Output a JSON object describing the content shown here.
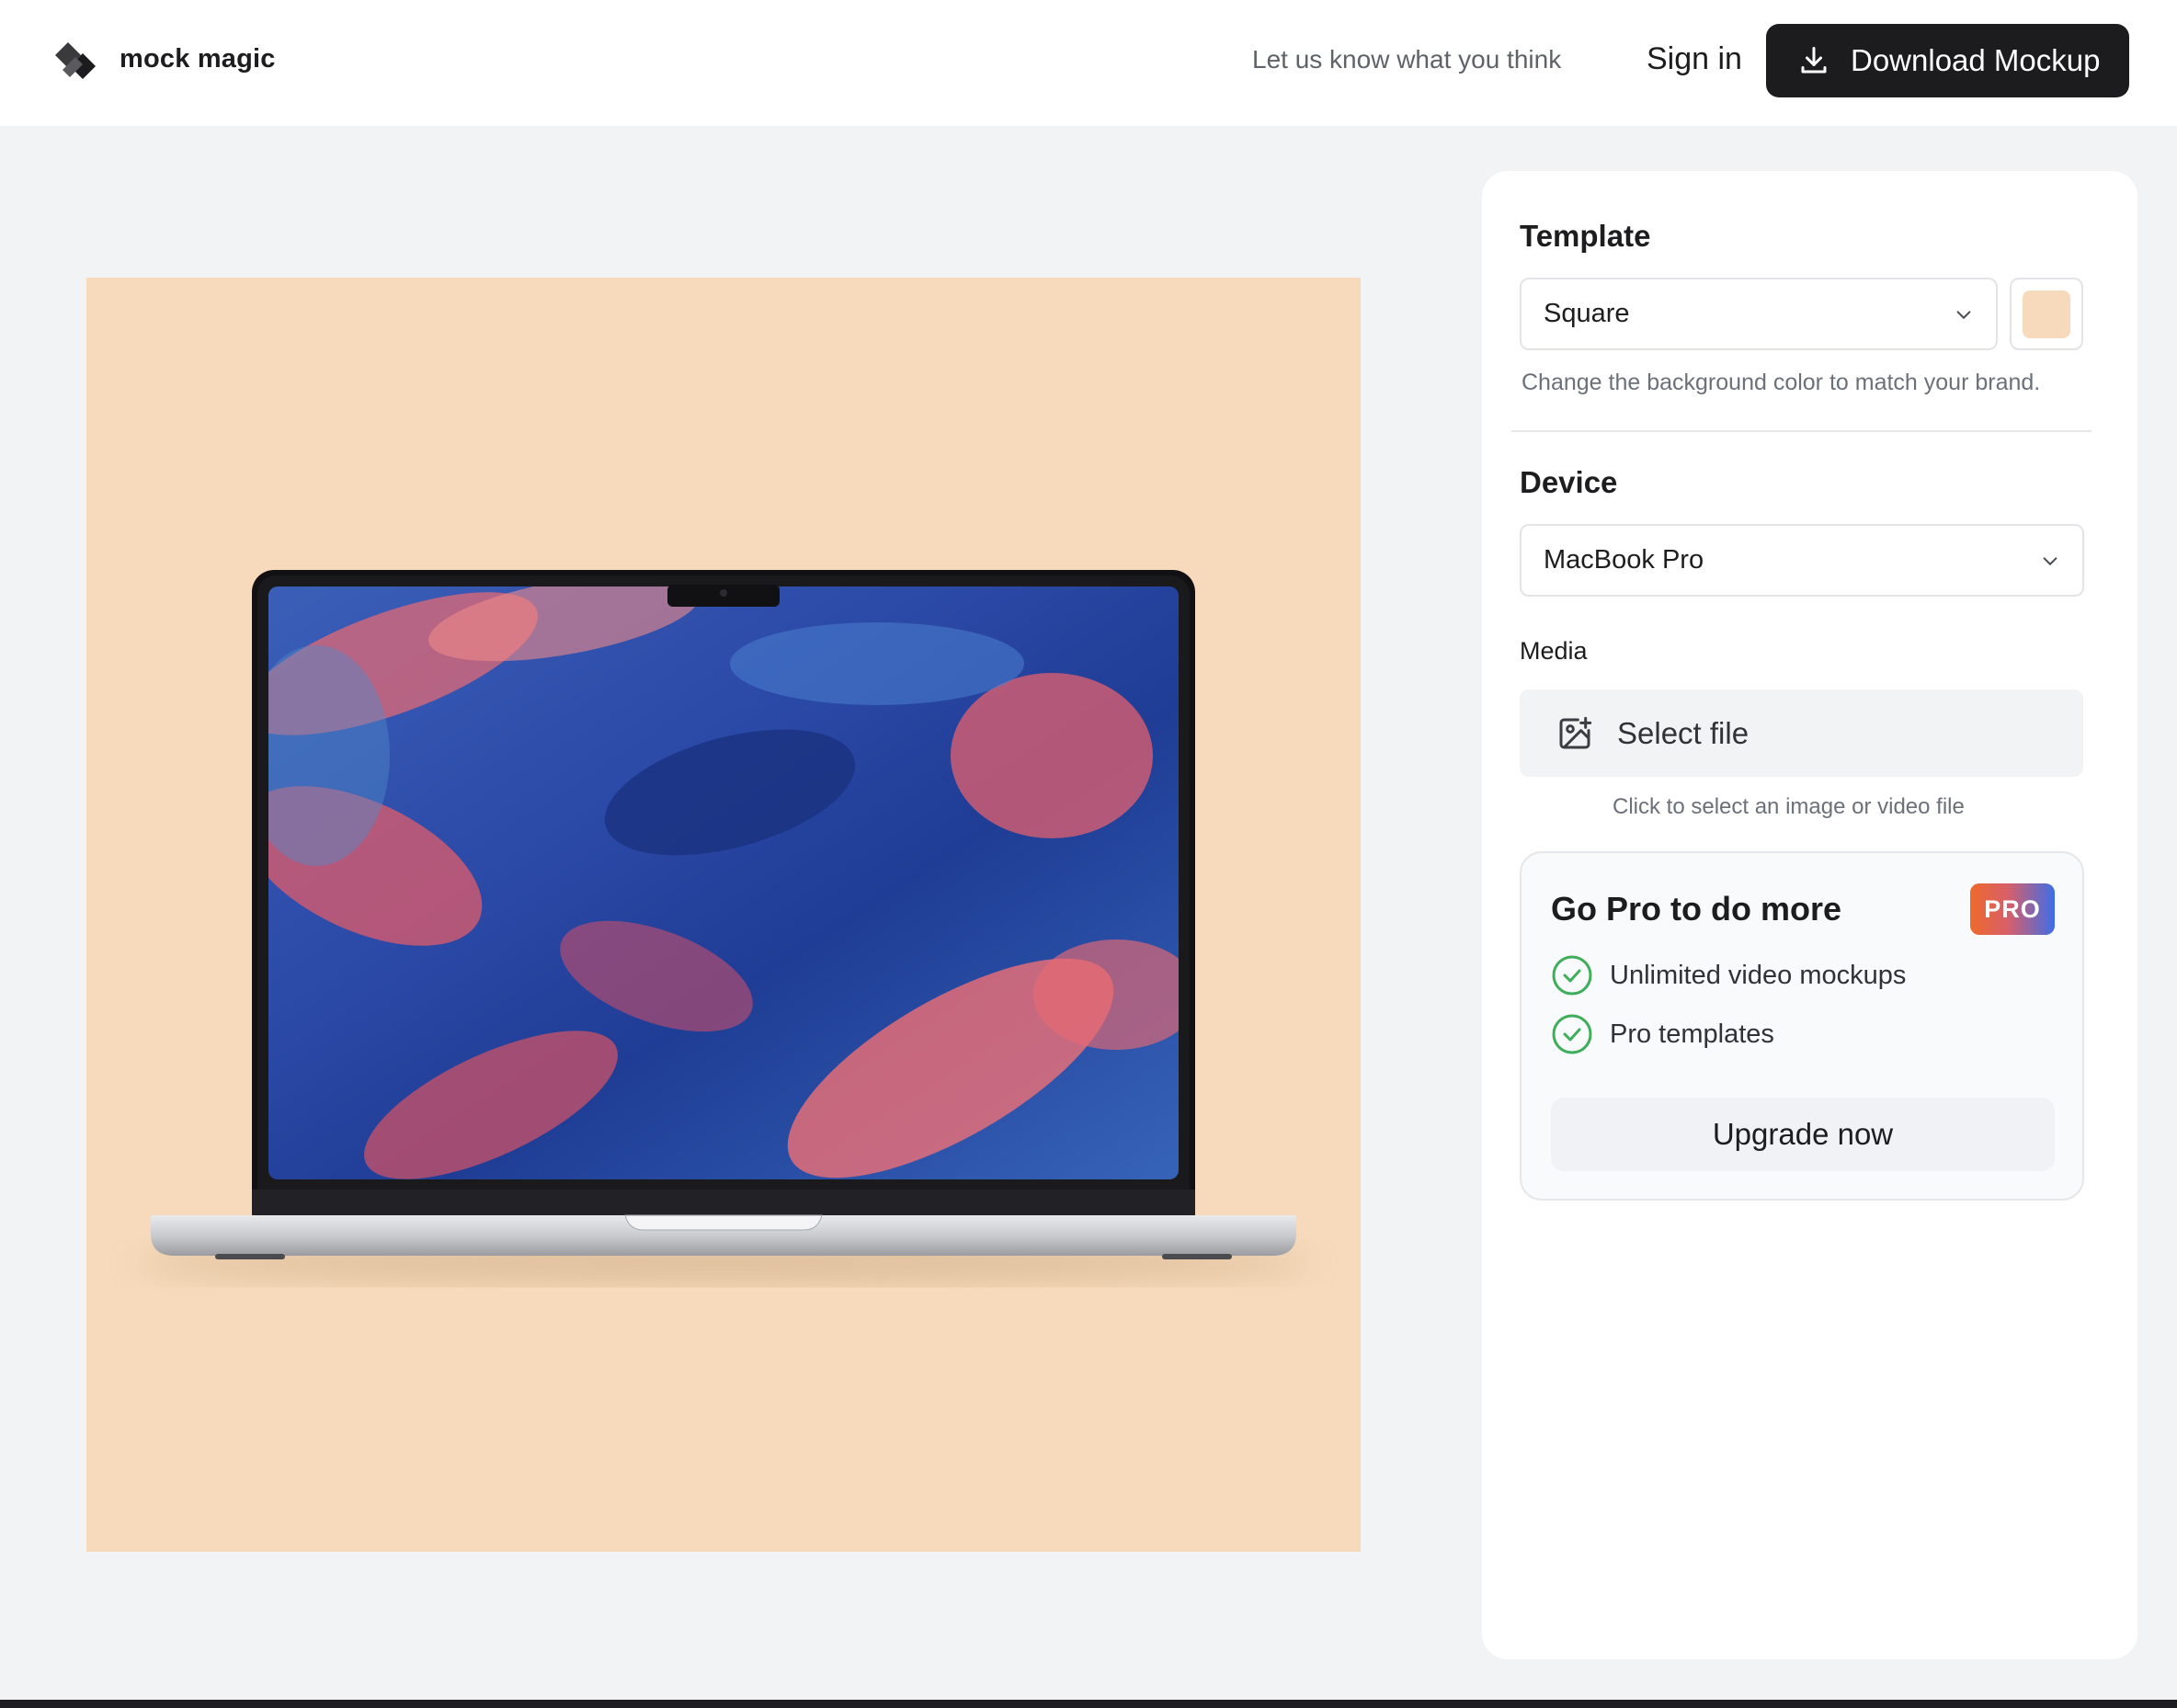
{
  "header": {
    "brand": "mock magic",
    "logo_icon": "stacked-shapes-logo",
    "feedback_link": "Let us know what you think",
    "signin_label": "Sign in",
    "download_label": "Download Mockup",
    "download_icon": "download-icon"
  },
  "canvas": {
    "background_color": "#f6dabb",
    "device_image": "macbook-pro-with-painted-wallpaper"
  },
  "panel": {
    "template": {
      "title": "Template",
      "selected": "Square",
      "swatch_color": "#f6dabb",
      "hint": "Change the background color to match your brand."
    },
    "device": {
      "title": "Device",
      "selected": "MacBook Pro"
    },
    "media": {
      "label": "Media",
      "select_file_label": "Select file",
      "select_file_icon": "image-add-icon",
      "hint": "Click to select an image or video file"
    },
    "pro": {
      "title": "Go Pro to do more",
      "badge": "PRO",
      "features": [
        "Unlimited video mockups",
        "Pro templates"
      ],
      "feature_icon": "check-circle-icon",
      "upgrade_label": "Upgrade now"
    }
  },
  "colors": {
    "accent_dark": "#1c1c1e",
    "check_green": "#3fae5a",
    "pro_gradient_start": "#ee6a2b",
    "pro_gradient_end": "#3d6de8"
  }
}
